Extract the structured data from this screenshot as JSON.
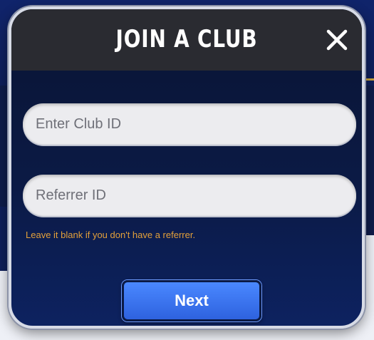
{
  "modal": {
    "title": "JOIN A CLUB",
    "club_id_placeholder": "Enter Club ID",
    "referrer_placeholder": "Referrer ID",
    "referrer_hint": "Leave it blank if you don't have a referrer.",
    "next_label": "Next",
    "close_icon": "close-icon"
  },
  "colors": {
    "hint": "#e3a03a",
    "button": "#3a74f0",
    "header": "#2a2b31"
  }
}
